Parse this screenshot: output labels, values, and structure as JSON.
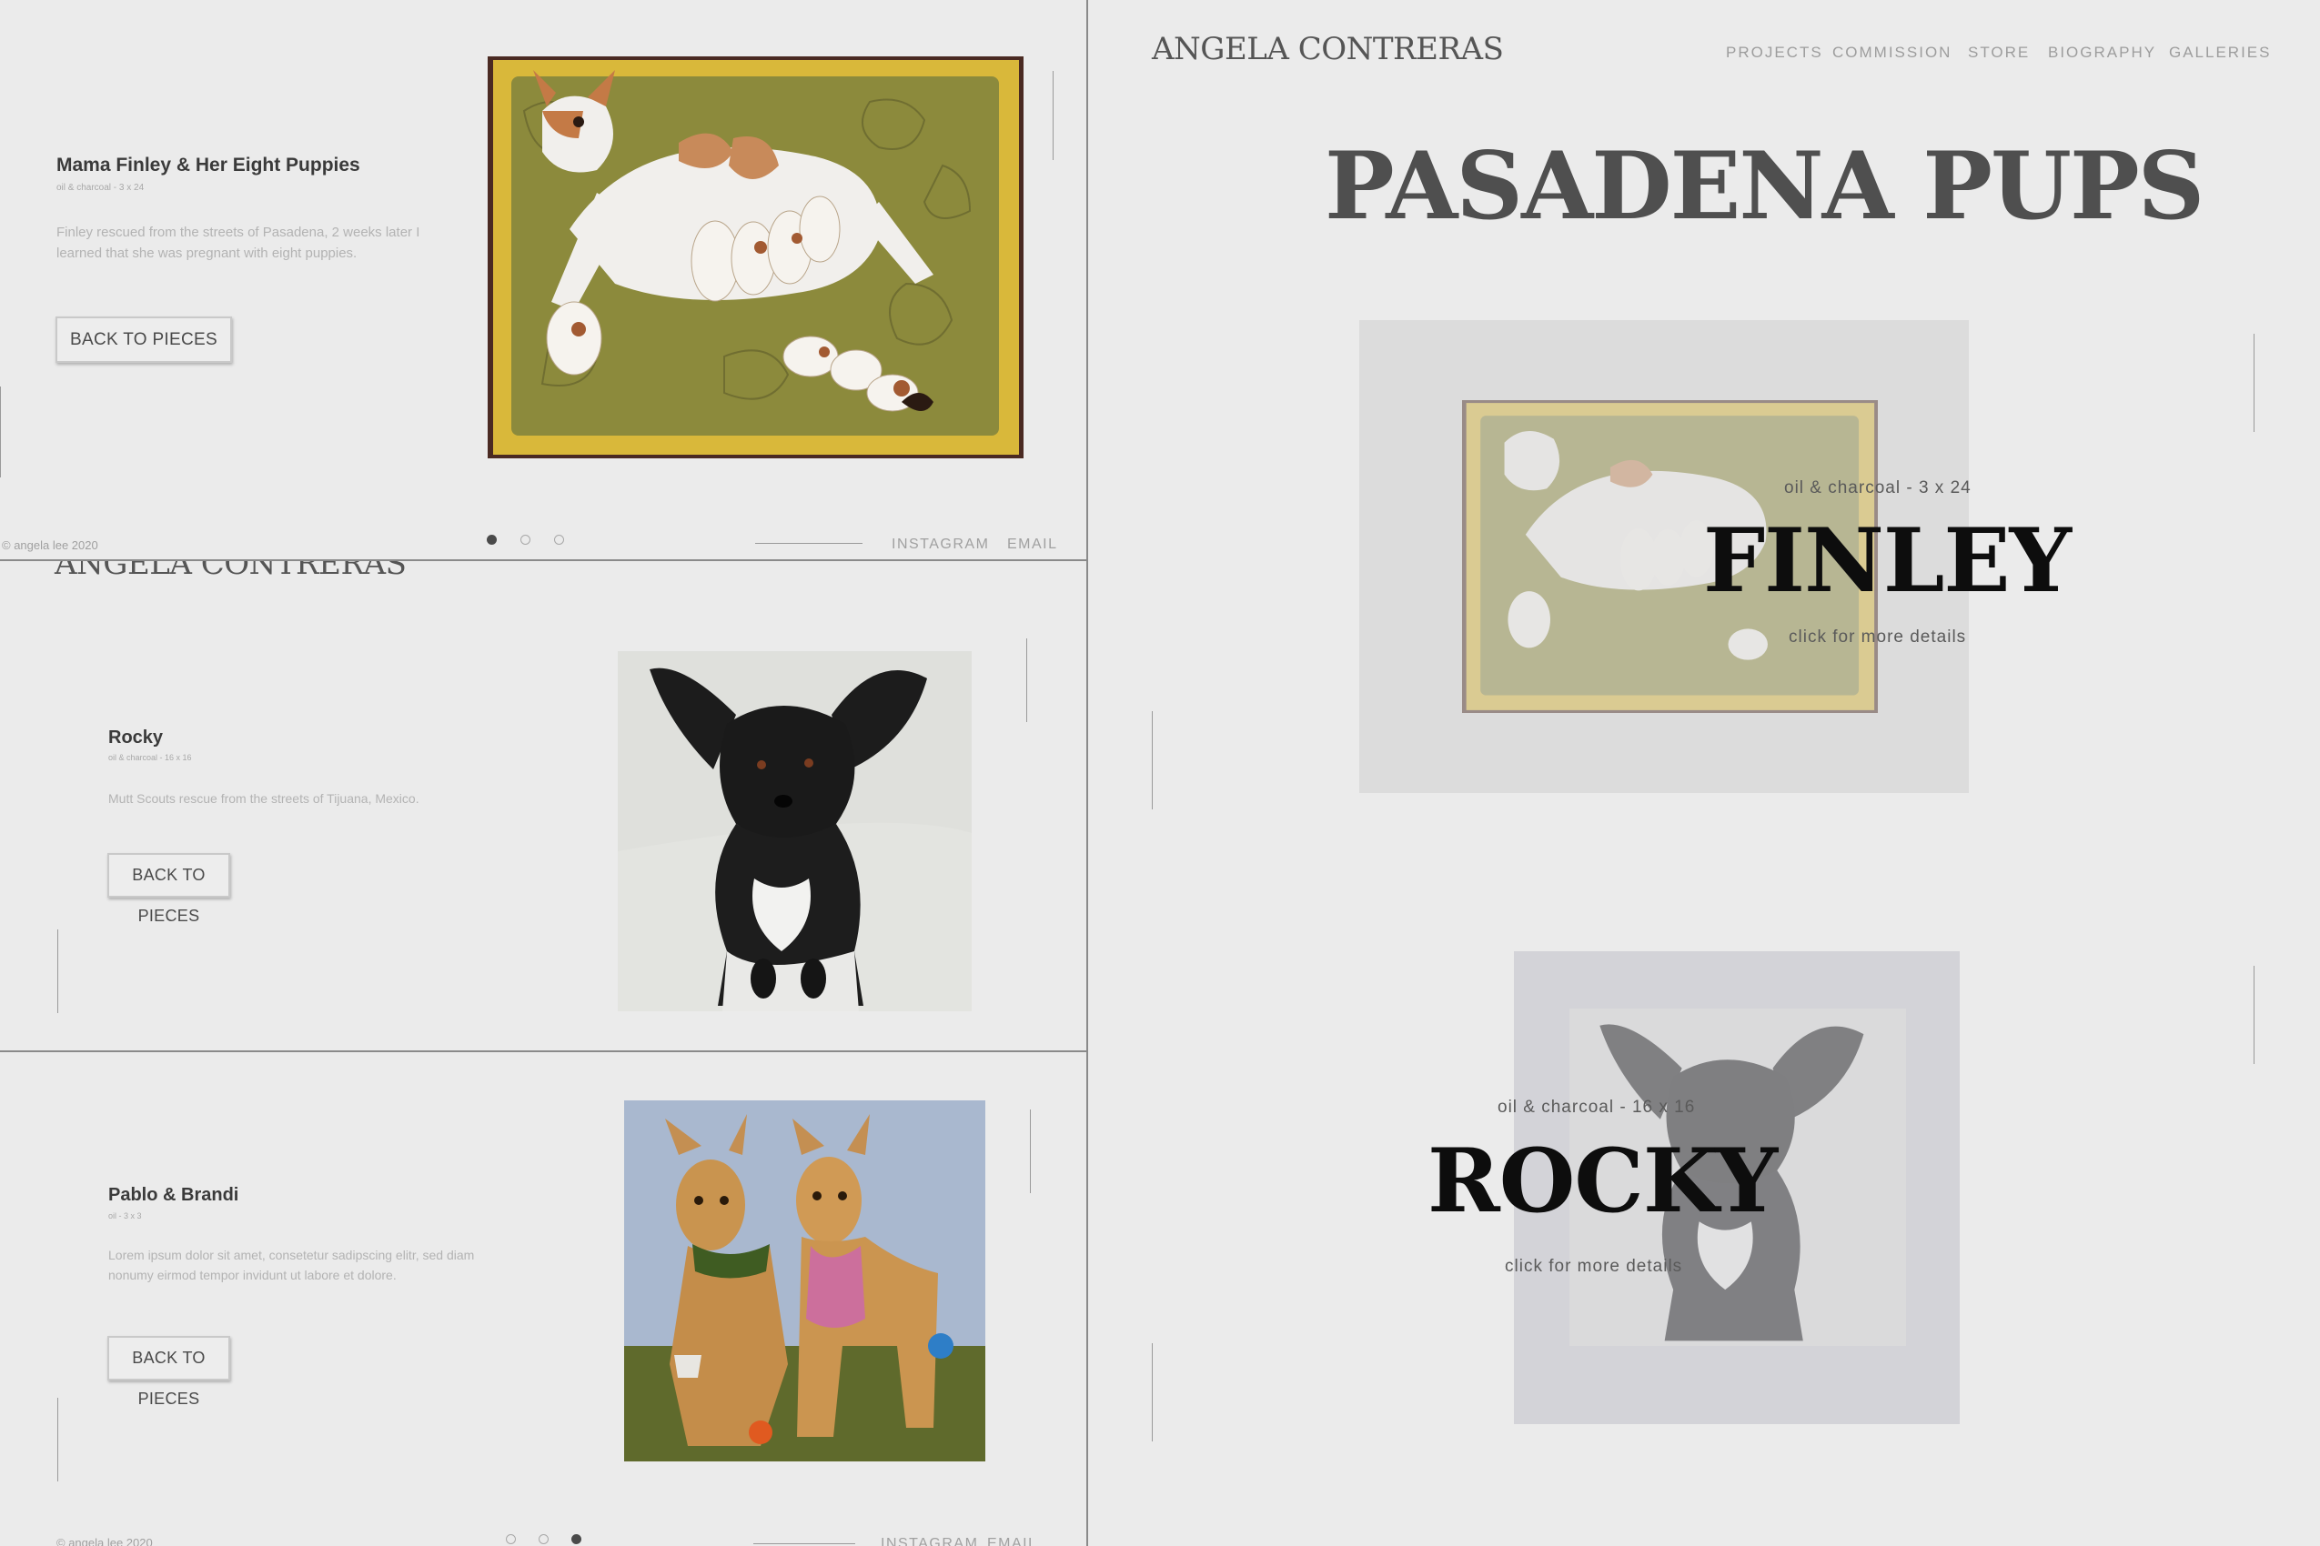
{
  "site": {
    "brand": "ANGELA CONTRERAS"
  },
  "nav": [
    "PROJECTS",
    "COMMISSION",
    "STORE",
    "BIOGRAPHY",
    "GALLERIES"
  ],
  "gallery": {
    "heading": "PASADENA PUPS"
  },
  "footer": {
    "copyright": "© angela lee 2020",
    "instagram": "INSTAGRAM",
    "email": "EMAIL"
  },
  "pieces": [
    {
      "title": "Mama Finley & Her Eight Puppies",
      "medium": "oil & charcoal - 3 x 24",
      "description": "Finley rescued from the streets of Pasadena, 2 weeks later I learned that she was pregnant with eight puppies.",
      "button": "BACK TO PIECES"
    },
    {
      "title": "Rocky",
      "medium": "oil & charcoal - 16 x 16",
      "description": "Mutt Scouts rescue from the streets of Tijuana, Mexico.",
      "button": "BACK TO PIECES"
    },
    {
      "title": "Pablo & Brandi",
      "medium": "oil - 3 x 3",
      "description": "Lorem ipsum dolor sit amet, consetetur sadipscing elitr, sed diam nonumy eirmod tempor invidunt ut labore et dolore.",
      "button": "BACK TO PIECES"
    }
  ],
  "cards": [
    {
      "name": "FINLEY",
      "medium": "oil & charcoal - 3 x 24",
      "cta": "click for more details"
    },
    {
      "name": "ROCKY",
      "medium": "oil & charcoal - 16 x 16",
      "cta": "click for more details"
    }
  ],
  "colors": {
    "background": "#ebebeb",
    "painting1_frame": "#d9b83a",
    "painting1_field": "#8c8a3c",
    "painting3_sky": "#a9b8cf",
    "painting3_ground": "#5f6a2c",
    "card2_bg": "#d3d3d8"
  }
}
